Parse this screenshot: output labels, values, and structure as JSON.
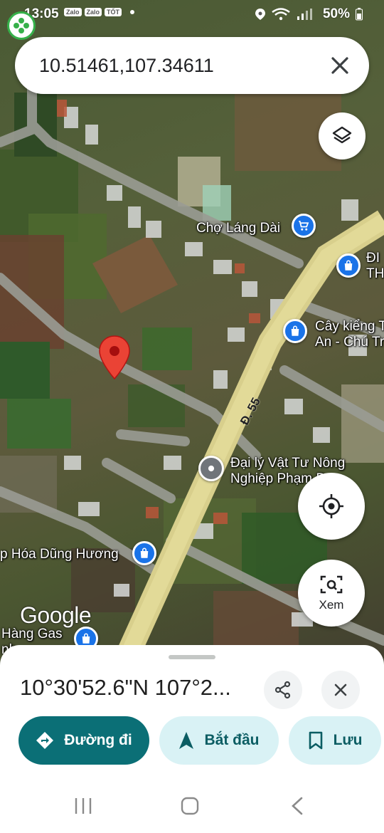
{
  "status_bar": {
    "time": "13:05",
    "app_chips": [
      "Zalo",
      "Zalo",
      "TỐT"
    ],
    "battery": "50%"
  },
  "search": {
    "value": "10.51461,107.34611"
  },
  "map": {
    "pois": [
      {
        "label": "Chợ Láng Dài",
        "icon": "shopping-cart-icon"
      },
      {
        "label": "ĐI\nTH",
        "icon": "shopping-bag-icon"
      },
      {
        "label": "Cây kiểng T\nAn - Chú Tr",
        "icon": "shopping-bag-icon"
      },
      {
        "label": "Đại lý Vật Tư Nông\nNghiệp Phạm Đ...",
        "icon": "location-pin-icon"
      },
      {
        "label": "p Hóa Dũng Hương",
        "icon": "shopping-bag-icon"
      },
      {
        "label": "Hàng Gas\nnh",
        "icon": "shopping-bag-icon"
      }
    ],
    "road_label": "Đ. 55",
    "logo": "Google",
    "dropped_pin_icon": "red-map-pin-icon"
  },
  "buttons": {
    "layers_icon": "layers-icon",
    "locate_icon": "my-location-icon",
    "explore_label": "Xem",
    "explore_icon": "camera-search-icon"
  },
  "sheet": {
    "coordinates": "10°30'52.6\"N 107°2...",
    "share_icon": "share-icon",
    "close_icon": "close-icon",
    "actions": {
      "directions": "Đường đi",
      "start": "Bắt đầu",
      "save": "Lưu"
    }
  },
  "colors": {
    "primary": "#0b6f76",
    "secondary_bg": "#d9f2f5",
    "pin_red": "#ea4335",
    "poi_blue": "#1a73e8"
  }
}
